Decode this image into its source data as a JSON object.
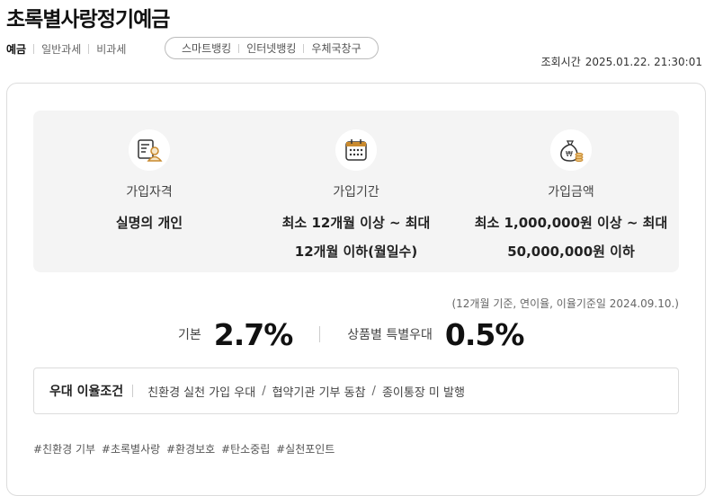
{
  "product": {
    "name": "초록별사랑정기예금"
  },
  "tax_tabs": [
    "예금",
    "일반과세",
    "비과세"
  ],
  "channels": [
    "스마트뱅킹",
    "인터넷뱅킹",
    "우체국창구"
  ],
  "inquiry": {
    "label": "조회시간",
    "datetime": "2025.01.22. 21:30:01"
  },
  "info": {
    "eligibility": {
      "label": "가입자격",
      "value": "실명의 개인",
      "icon": "person-document-icon"
    },
    "period": {
      "label": "가입기간",
      "value_line1": "최소 12개월 이상 ~ 최대",
      "value_line2": "12개월 이하(월일수)",
      "icon": "calendar-icon"
    },
    "amount": {
      "label": "가입금액",
      "value_line1": "최소 1,000,000원 이상 ~ 최대",
      "value_line2": "50,000,000원 이하",
      "icon": "money-bag-icon"
    }
  },
  "rate_basis": "(12개월 기준, 연이율, 이율기준일 2024.09.10.)",
  "rates": {
    "base_label": "기본",
    "base_value": "2.7%",
    "special_label": "상품별 특별우대",
    "special_value": "0.5%"
  },
  "preferential": {
    "title": "우대 이율조건",
    "items": [
      "친환경 실천 가입 우대",
      "협약기관 기부 동참",
      "종이통장 미 발행"
    ]
  },
  "hashtags": [
    "#친환경 기부",
    "#초록별사랑",
    "#환경보호",
    "#탄소중립",
    "#실천포인트"
  ],
  "colors": {
    "icon_accent": "#c98a2e",
    "info_box_bg": "#f4f4f4"
  }
}
